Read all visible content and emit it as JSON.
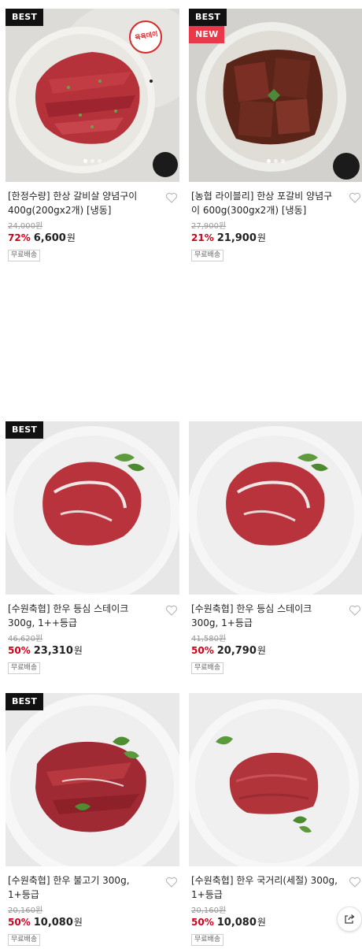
{
  "products": [
    {
      "title": "[한정수량] 한상 갈비살 양념구이 400g(200gx2개) [냉동]",
      "original_price": "24,000원",
      "discount": "72%",
      "price": "6,600",
      "currency": "원",
      "shipping": "무료배송",
      "badges": [
        "BEST"
      ],
      "stamp": "육육데이",
      "image_dots": 3
    },
    {
      "title": "[농협 라이블리] 한상 포갈비 양념구이 600g(300gx2개) [냉동]",
      "original_price": "27,900원",
      "discount": "21%",
      "price": "21,900",
      "currency": "원",
      "shipping": "무료배송",
      "badges": [
        "BEST",
        "NEW"
      ],
      "image_dots": 3
    },
    {
      "title": "[수원축협] 한우 등심 스테이크 300g, 1++등급",
      "original_price": "46,620원",
      "discount": "50%",
      "price": "23,310",
      "currency": "원",
      "shipping": "무료배송",
      "badges": [
        "BEST"
      ]
    },
    {
      "title": "[수원축협] 한우 등심 스테이크 300g, 1+등급",
      "original_price": "41,580원",
      "discount": "50%",
      "price": "20,790",
      "currency": "원",
      "shipping": "무료배송",
      "badges": []
    },
    {
      "title": "[수원축협] 한우 불고기 300g, 1+등급",
      "original_price": "20,160원",
      "discount": "50%",
      "price": "10,080",
      "currency": "원",
      "shipping": "무료배송",
      "badges": [
        "BEST"
      ]
    },
    {
      "title": "[수원축협] 한우 국거리(세절) 300g, 1+등급",
      "original_price": "20,160원",
      "discount": "50%",
      "price": "10,080",
      "currency": "원",
      "shipping": "무료배송",
      "badges": []
    }
  ],
  "icons": {
    "wishlist": "heart-outline-icon",
    "share": "share-icon"
  },
  "colors": {
    "discount": "#d0021b",
    "best_badge": "#111111",
    "new_badge": "#e8384a",
    "stamp": "#d62b2b"
  }
}
